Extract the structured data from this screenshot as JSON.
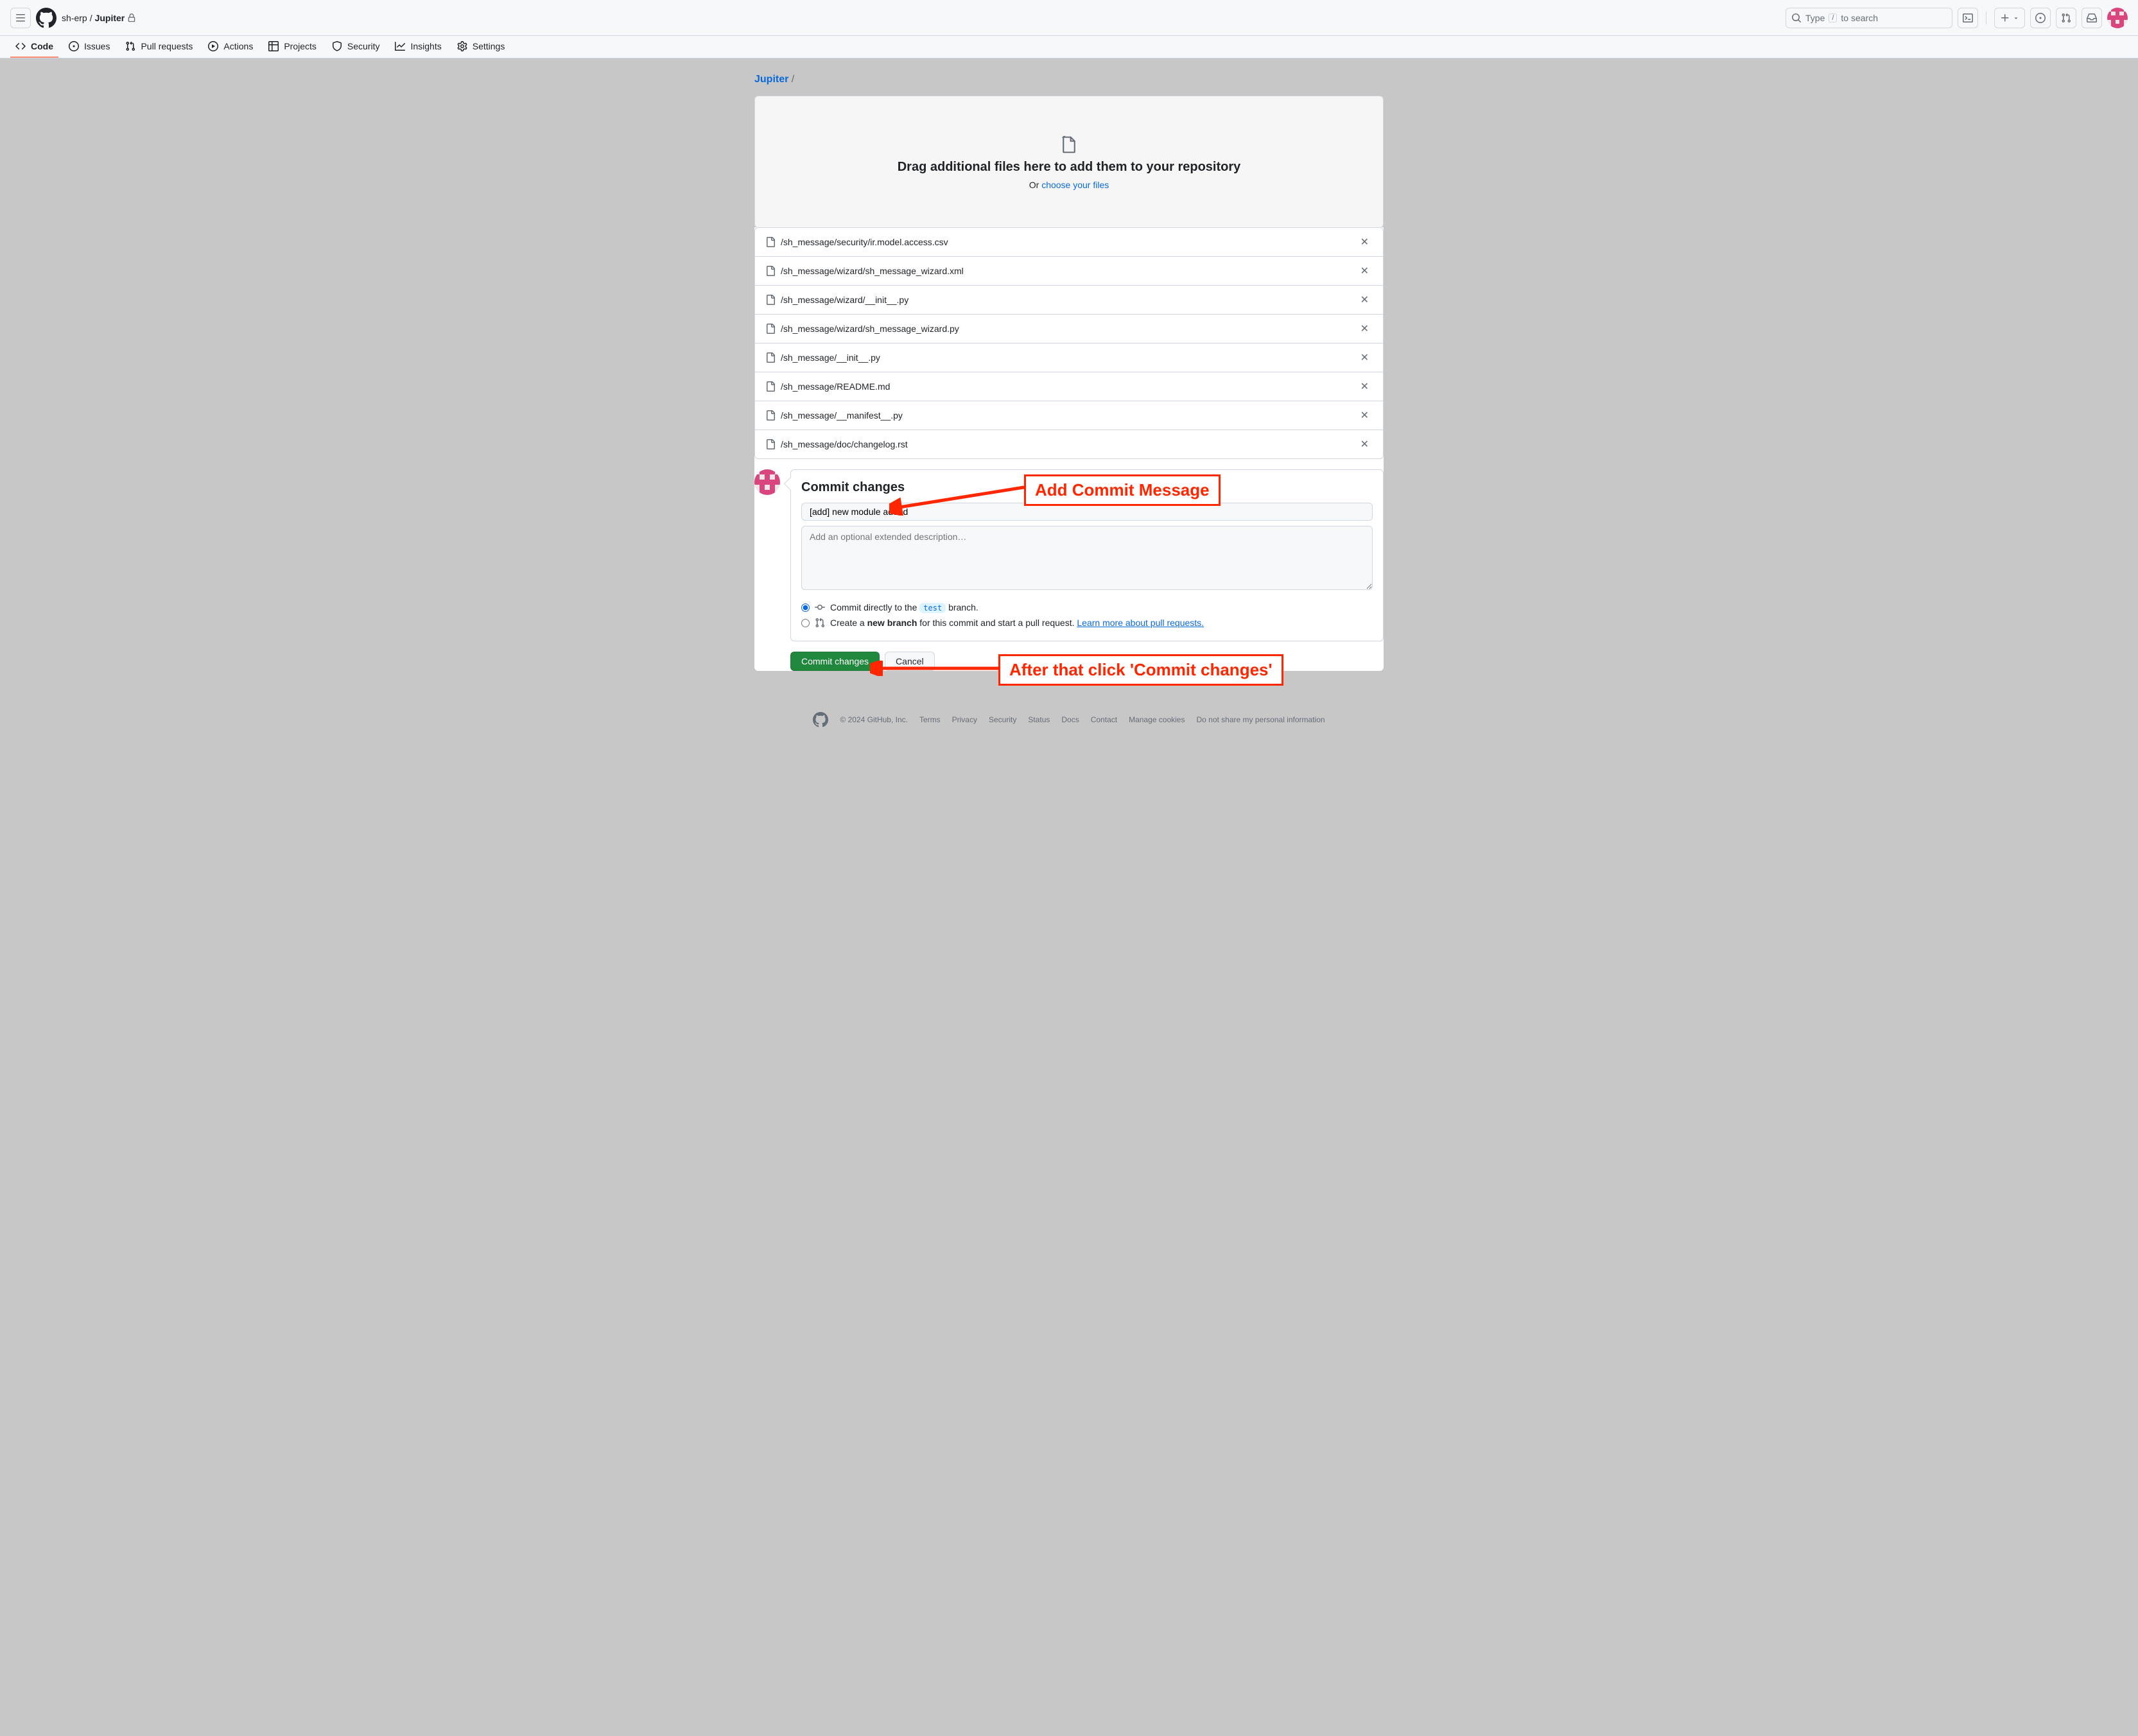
{
  "header": {
    "owner": "sh-erp",
    "repo": "Jupiter",
    "search_placeholder": "Type",
    "search_hint": "to search",
    "slash_key": "/"
  },
  "nav": {
    "code": "Code",
    "issues": "Issues",
    "pulls": "Pull requests",
    "actions": "Actions",
    "projects": "Projects",
    "security": "Security",
    "insights": "Insights",
    "settings": "Settings"
  },
  "breadcrumb": {
    "repo": "Jupiter",
    "sep": "/"
  },
  "dropzone": {
    "heading": "Drag additional files here to add them to your repository",
    "or": "Or ",
    "choose": "choose your files"
  },
  "files": [
    "/sh_message/security/ir.model.access.csv",
    "/sh_message/wizard/sh_message_wizard.xml",
    "/sh_message/wizard/__init__.py",
    "/sh_message/wizard/sh_message_wizard.py",
    "/sh_message/__init__.py",
    "/sh_message/README.md",
    "/sh_message/__manifest__.py",
    "/sh_message/doc/changelog.rst"
  ],
  "commit": {
    "heading": "Commit changes",
    "message_value": "[add] new module added",
    "desc_placeholder": "Add an optional extended description…",
    "radio_direct_pre": "Commit directly to the ",
    "radio_direct_branch": "test",
    "radio_direct_post": " branch.",
    "radio_newbranch_pre": "Create a ",
    "radio_newbranch_bold": "new branch",
    "radio_newbranch_post": " for this commit and start a pull request. ",
    "learn_more": "Learn more about pull requests.",
    "btn_commit": "Commit changes",
    "btn_cancel": "Cancel"
  },
  "annotations": {
    "add_msg": "Add Commit Message",
    "click_commit": "After that click 'Commit changes'"
  },
  "footer": {
    "copyright": "© 2024 GitHub, Inc.",
    "terms": "Terms",
    "privacy": "Privacy",
    "security": "Security",
    "status": "Status",
    "docs": "Docs",
    "contact": "Contact",
    "cookies": "Manage cookies",
    "personal": "Do not share my personal information"
  }
}
